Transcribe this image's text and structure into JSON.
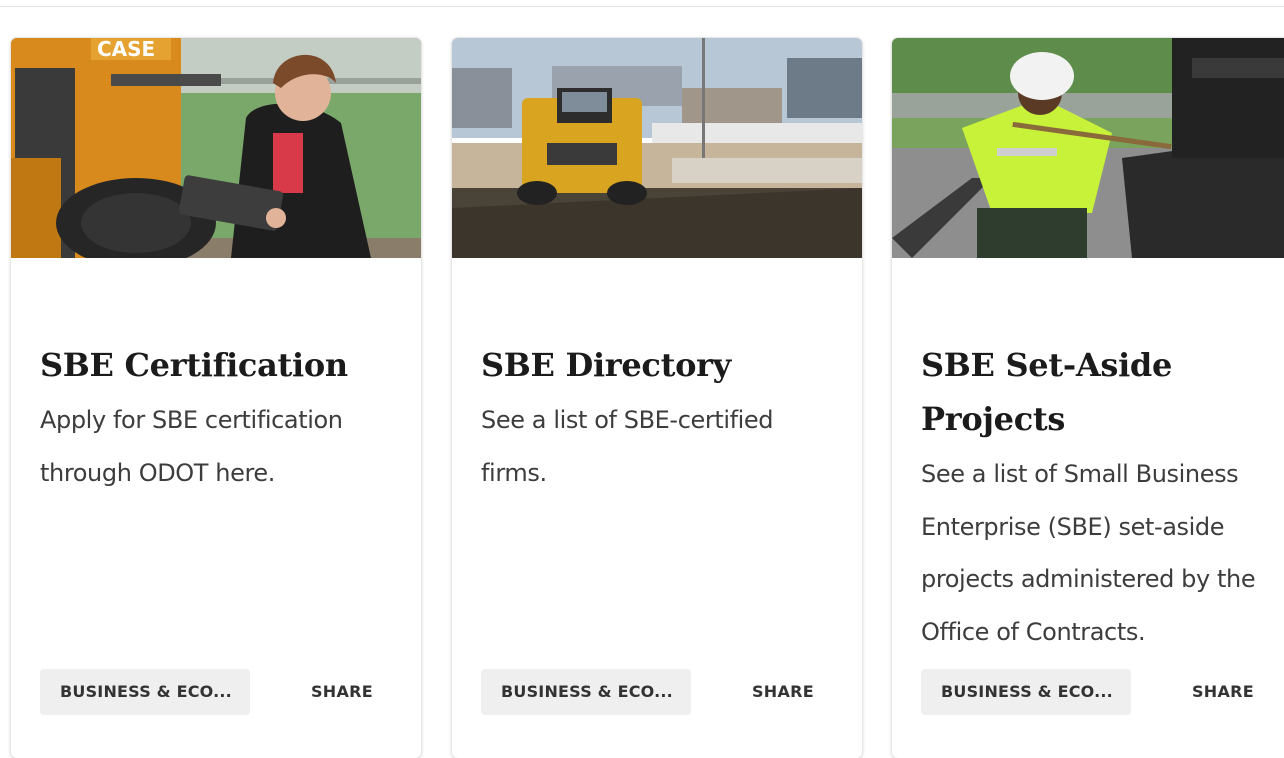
{
  "cards": [
    {
      "title": "SBE Certification",
      "description": "Apply for SBE certification through ODOT here.",
      "tag": "BUSINESS & ECO...",
      "share": "SHARE",
      "image_alt": "Woman with a tablet next to a Case construction machine",
      "image_brand_text": "CASE"
    },
    {
      "title": "SBE Directory",
      "description": "See a list of SBE-certified firms.",
      "tag": "BUSINESS & ECO...",
      "share": "SHARE",
      "image_alt": "Yellow dump truck at a highway construction site"
    },
    {
      "title": "SBE Set-Aside Projects",
      "description": "See a list of Small Business Enterprise (SBE) set-aside projects administered by the Office of Contracts.",
      "tag": "BUSINESS & ECO...",
      "share": "SHARE",
      "image_alt": "Worker in hi-vis shirt and hard hat raking asphalt"
    }
  ]
}
